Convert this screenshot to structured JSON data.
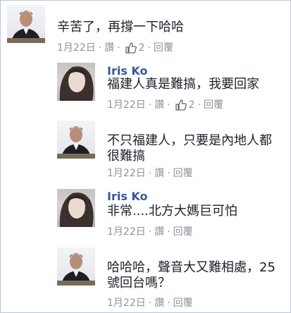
{
  "comments": [
    {
      "name": "",
      "text_lines": [
        "辛苦了，再撐一下哈哈"
      ],
      "date": "1月22日",
      "sep": "·",
      "like_label": "讚",
      "like_count": "2",
      "reply_label": "回覆"
    },
    {
      "name": "Iris Ko",
      "text_lines": [
        "福建人真是難搞，我要回家"
      ],
      "date": "1月22日",
      "sep": "·",
      "like_label": "讚",
      "like_count": "2",
      "reply_label": "回覆"
    },
    {
      "name": "",
      "text_lines": [
        "不只福建人，只要是內地人都",
        "很難搞"
      ],
      "date": "1月22日",
      "sep": "·",
      "like_label": "讚",
      "reply_label": "回覆"
    },
    {
      "name": "Iris Ko",
      "text_lines": [
        "非常....北方大媽巨可怕"
      ],
      "date": "1月22日",
      "sep": "·",
      "like_label": "讚",
      "reply_label": "回覆"
    },
    {
      "name": "",
      "text_lines": [
        "哈哈哈，聲音大又難相處，25",
        "號回台嗎？"
      ],
      "date": "1月22日",
      "sep": "·",
      "like_label": "讚",
      "reply_label": "回覆"
    }
  ],
  "colors": {
    "name_link": "#365899",
    "meta_gray": "#90949c",
    "like_icon": "#606770"
  },
  "icons": {
    "like": "thumbs-up-icon"
  }
}
